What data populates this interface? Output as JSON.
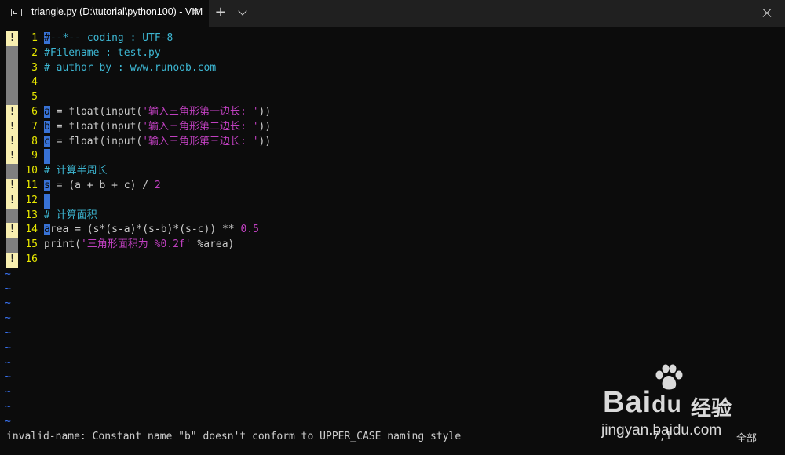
{
  "window": {
    "tab_title": "triangle.py (D:\\tutorial\\python100) - VIM",
    "close_tab_glyph": "✕",
    "new_tab_glyph": "+",
    "icons": [
      "terminal-icon",
      "close-icon",
      "plus-icon",
      "chevron-down-icon",
      "minimize-icon",
      "maximize-icon",
      "close-window-icon"
    ]
  },
  "editor": {
    "lines": [
      {
        "n": "1",
        "sign": "!",
        "text": "#--*-- coding : UTF-8"
      },
      {
        "n": "2",
        "sign": "",
        "text": "#Filename : test.py"
      },
      {
        "n": "3",
        "sign": "",
        "text": "# author by : www.runoob.com"
      },
      {
        "n": "4",
        "sign": "",
        "text": ""
      },
      {
        "n": "5",
        "sign": "",
        "text": ""
      },
      {
        "n": "6",
        "sign": "!",
        "text": "a = float(input('输入三角形第一边长: '))"
      },
      {
        "n": "7",
        "sign": "!",
        "text": "b = float(input('输入三角形第二边长: '))"
      },
      {
        "n": "8",
        "sign": "!",
        "text": "c = float(input('输入三角形第三边长: '))"
      },
      {
        "n": "9",
        "sign": "!",
        "text": ""
      },
      {
        "n": "10",
        "sign": "",
        "text": "# 计算半周长"
      },
      {
        "n": "11",
        "sign": "!",
        "text": "s = (a + b + c) / 2"
      },
      {
        "n": "12",
        "sign": "!",
        "text": ""
      },
      {
        "n": "13",
        "sign": "",
        "text": "# 计算面积"
      },
      {
        "n": "14",
        "sign": "!",
        "text": "area = (s*(s-a)*(s-b)*(s-c)) ** 0.5"
      },
      {
        "n": "15",
        "sign": "",
        "text": "print('三角形面积为 %0.2f' %area)"
      },
      {
        "n": "16",
        "sign": "!",
        "text": ""
      }
    ],
    "tilde": "~",
    "empty_line_count": 11
  },
  "status": {
    "message": "invalid-name: Constant name \"b\" doesn't conform to UPPER_CASE naming style",
    "ruler": "7,1",
    "position": "全部"
  },
  "watermark": {
    "brand": "Bai",
    "brand_du": "du",
    "cn": "经验",
    "url": "jingyan.baidu.com"
  },
  "colors": {
    "background": "#0c0c0c",
    "line_number": "#e8e800",
    "comment": "#3db7d3",
    "string": "#c040c0",
    "cursor": "#3872d6",
    "warning_sign": "#f8efb0",
    "tilde": "#3b78ff"
  }
}
